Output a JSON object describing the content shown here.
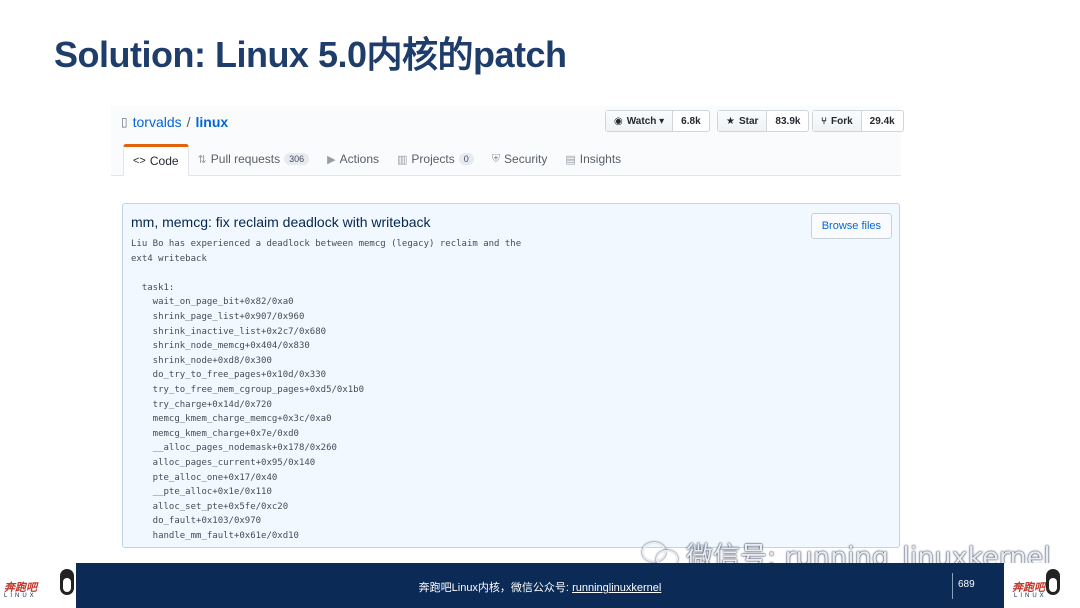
{
  "slide": {
    "title": "Solution: Linux 5.0内核的patch"
  },
  "repo": {
    "owner": "torvalds",
    "separator": "/",
    "name": "linux",
    "watch": {
      "label": "Watch ▾",
      "count": "6.8k",
      "icon": "eye-icon"
    },
    "star": {
      "label": "Star",
      "count": "83.9k",
      "icon": "star-icon"
    },
    "fork": {
      "label": "Fork",
      "count": "29.4k",
      "icon": "fork-icon"
    }
  },
  "tabs": [
    {
      "label": "Code",
      "icon": "code-icon",
      "count": ""
    },
    {
      "label": "Pull requests",
      "icon": "pull-request-icon",
      "count": "306"
    },
    {
      "label": "Actions",
      "icon": "play-icon",
      "count": ""
    },
    {
      "label": "Projects",
      "icon": "project-icon",
      "count": "0"
    },
    {
      "label": "Security",
      "icon": "shield-icon",
      "count": ""
    },
    {
      "label": "Insights",
      "icon": "graph-icon",
      "count": ""
    }
  ],
  "commit": {
    "title": "mm, memcg: fix reclaim deadlock with writeback",
    "browse_label": "Browse files",
    "message": "Liu Bo has experienced a deadlock between memcg (legacy) reclaim and the\next4 writeback\n\n  task1:\n    wait_on_page_bit+0x82/0xa0\n    shrink_page_list+0x907/0x960\n    shrink_inactive_list+0x2c7/0x680\n    shrink_node_memcg+0x404/0x830\n    shrink_node+0xd8/0x300\n    do_try_to_free_pages+0x10d/0x330\n    try_to_free_mem_cgroup_pages+0xd5/0x1b0\n    try_charge+0x14d/0x720\n    memcg_kmem_charge_memcg+0x3c/0xa0\n    memcg_kmem_charge+0x7e/0xd0\n    __alloc_pages_nodemask+0x178/0x260\n    alloc_pages_current+0x95/0x140\n    pte_alloc_one+0x17/0x40\n    __pte_alloc+0x1e/0x110\n    alloc_set_pte+0x5fe/0xc20\n    do_fault+0x103/0x970\n    handle_mm_fault+0x61e/0xd10"
  },
  "footer": {
    "text_prefix": "奔跑吧Linux内核，微信公众号: ",
    "text_link": "runninglinuxkernel",
    "page_number": "689",
    "logo_text": "奔跑吧",
    "logo_sub": "LINUX"
  },
  "watermark": {
    "text": "微信号: running_linuxkernel"
  }
}
